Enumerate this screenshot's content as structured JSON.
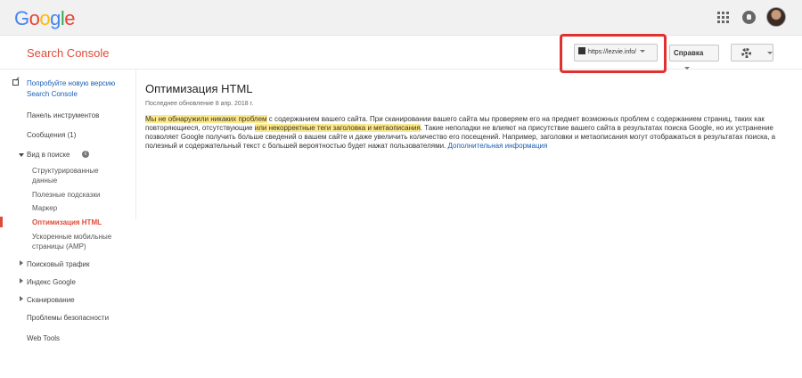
{
  "topbar": {
    "logo_letters": [
      {
        "ch": "G",
        "color": "#4285F4"
      },
      {
        "ch": "o",
        "color": "#EA4335"
      },
      {
        "ch": "o",
        "color": "#FBBC05"
      },
      {
        "ch": "g",
        "color": "#4285F4"
      },
      {
        "ch": "l",
        "color": "#34A853"
      },
      {
        "ch": "e",
        "color": "#EA4335"
      }
    ],
    "icons": [
      "apps-grid-icon",
      "notifications-icon",
      "avatar"
    ]
  },
  "header": {
    "title": "Search Console",
    "site_selector": "https://lezvie.info/",
    "help_label": "Справка",
    "highlight_color": "#e03030"
  },
  "sidebar": {
    "try_new": "Попробуйте новую версию",
    "try_new_2": "Search Console",
    "dashboard": "Панель инструментов",
    "messages": "Сообщения (1)",
    "search_appearance": "Вид в поиске",
    "structured_data_1": "Структурированные",
    "structured_data_2": "данные",
    "rich_cards": "Полезные подсказки",
    "highlighter": "Маркер",
    "html_improvements": "Оптимизация HTML",
    "amp_1": "Ускоренные мобильные",
    "amp_2": "страницы (AMP)",
    "search_traffic": "Поисковый трафик",
    "google_index": "Индекс Google",
    "crawl": "Сканирование",
    "security": "Проблемы безопасности",
    "web_tools": "Web Tools"
  },
  "main": {
    "title": "Оптимизация HTML",
    "updated": "Последнее обновление 8 апр. 2018 г.",
    "p1_hl": "Мы не обнаружили никаких проблем",
    "p2": " с содержанием вашего сайта. При сканировании вашего сайта мы проверяем его на предмет возможных проблем с содержанием страниц, таких как повторяющиеся, отсутствующие ",
    "p3_hl": "или некорректные теги заголовка и метаописания",
    "p4": ". Такие неполадки не влияют на присутствие вашего сайта в результатах поиска Google, но их устранение позволяет Google получить больше сведений о вашем сайте и даже увеличить количество его посещений. Например, заголовки и метаописания могут отображаться в результатах поиска, а полезный и содержательный текст с большей вероятностью будет нажат пользователями. ",
    "more_link": "Дополнительная информация"
  }
}
